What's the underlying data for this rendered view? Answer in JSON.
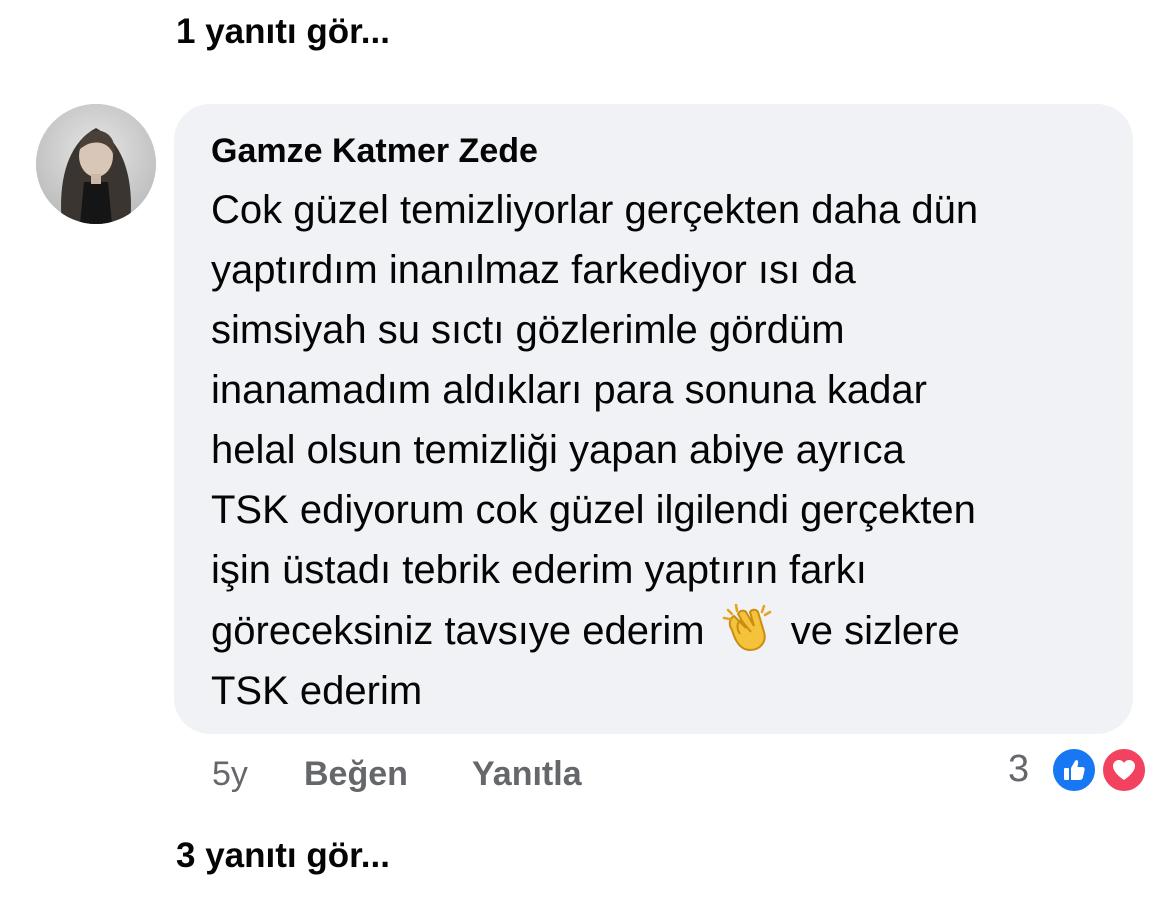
{
  "top_link": {
    "label": "1 yanıtı gör..."
  },
  "comment": {
    "author": "Gamze Katmer Zede",
    "lines": [
      "Cok güzel temizliyorlar gerçekten daha dün",
      "yaptırdım inanılmaz farkediyor ısı da",
      "simsiyah su sıctı gözlerimle gördüm",
      "inanamadım aldıkları para sonuna kadar",
      "helal olsun temizliği yapan abiye ayrıca",
      "TSK ediyorum cok güzel ilgilendi gerçekten",
      "işin üstadı tebrik ederim yaptırın farkı"
    ],
    "line8_before_emoji": "göreceksiniz tavsıye ederim",
    "line8_after_emoji": "ve sizlere",
    "line9": "TSK ederim",
    "emoji": "clapping-hands-icon",
    "time": "5y",
    "like_label": "Beğen",
    "reply_label": "Yanıtla",
    "reaction_count": "3",
    "reaction_icons": [
      "like-icon",
      "love-icon"
    ]
  },
  "bottom_link": {
    "label": "3 yanıtı gör..."
  },
  "colors": {
    "bubble": "#f0f2f5",
    "secondary_text": "#65676b",
    "like_blue": "#1877f2",
    "love_red": "#f3425f"
  }
}
